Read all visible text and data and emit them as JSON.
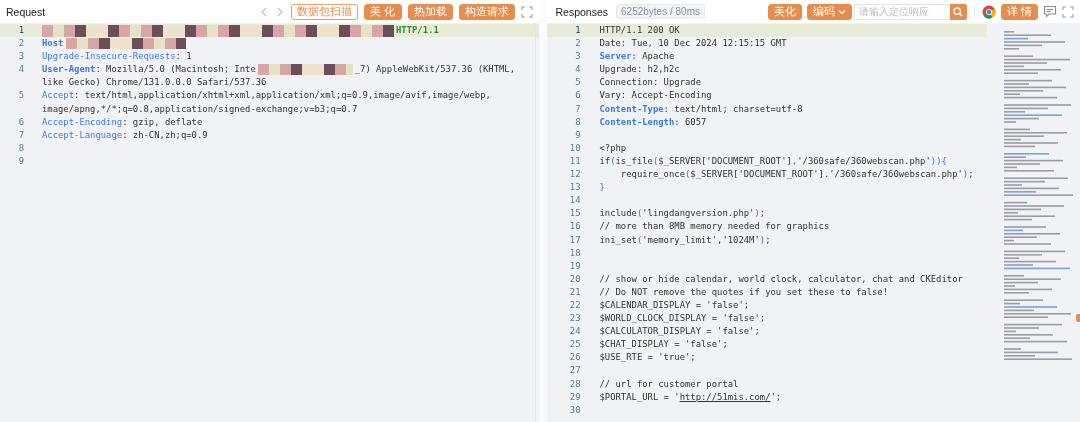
{
  "request": {
    "title": "Request",
    "toolbar": [
      {
        "kind": "prev"
      },
      {
        "kind": "next"
      },
      {
        "kind": "outline",
        "label": "数据包扫描"
      },
      {
        "kind": "filled",
        "label": "美 化"
      },
      {
        "kind": "filled",
        "label": "热加载"
      },
      {
        "kind": "filled",
        "label": "构造请求"
      },
      {
        "kind": "expand"
      }
    ],
    "lines": [
      {
        "number": "1",
        "highlighted": true,
        "rows": [
          [
            {
              "kind": "redacted_line"
            },
            {
              "kind": "proto",
              "text": "HTTP/1.1"
            }
          ]
        ]
      },
      {
        "number": "2",
        "highlighted": false,
        "rows": [
          [
            {
              "kind": "key_strong",
              "text": "Host"
            },
            {
              "kind": "redacted_word"
            }
          ]
        ]
      },
      {
        "number": "3",
        "highlighted": false,
        "rows": [
          [
            {
              "kind": "key",
              "text": "Upgrade-Insecure-Requests"
            },
            {
              "kind": "text",
              "text": ": 1"
            }
          ]
        ]
      },
      {
        "number": "4",
        "highlighted": false,
        "rows": [
          [
            {
              "kind": "key_strong",
              "text": "User-Agent"
            },
            {
              "kind": "text",
              "text": ": Mozilla/5.0 (Macintosh; Inte"
            },
            {
              "kind": "redacted_short"
            },
            {
              "kind": "text",
              "text": "_7) AppleWebKit/537.36 (KHTML,"
            }
          ],
          [
            {
              "kind": "text",
              "text": "like Gecko) Chrome/131.0.0.0 Safari/537.36"
            }
          ]
        ]
      },
      {
        "number": "5",
        "highlighted": false,
        "rows": [
          [
            {
              "kind": "key",
              "text": "Accept"
            },
            {
              "kind": "text",
              "text": ": text/html,application/xhtml+xml,application/xml;q=0.9,image/avif,image/webp,"
            }
          ],
          [
            {
              "kind": "text",
              "text": "image/apng,*/*;q=0.8,application/signed-exchange;v=b3;q=0.7"
            }
          ]
        ]
      },
      {
        "number": "6",
        "highlighted": false,
        "rows": [
          [
            {
              "kind": "key",
              "text": "Accept-Encoding"
            },
            {
              "kind": "text",
              "text": ": gzip, deflate"
            }
          ]
        ]
      },
      {
        "number": "7",
        "highlighted": false,
        "rows": [
          [
            {
              "kind": "key",
              "text": "Accept-Language"
            },
            {
              "kind": "text",
              "text": ": zh-CN,zh;q=0.9"
            }
          ]
        ]
      },
      {
        "number": "8",
        "highlighted": false,
        "rows": [
          []
        ]
      },
      {
        "number": "9",
        "highlighted": false,
        "rows": [
          []
        ]
      }
    ]
  },
  "response": {
    "title": "Responses",
    "stats": "6252bytes / 80ms",
    "toolbar": [
      {
        "kind": "filled",
        "label": "美化"
      },
      {
        "kind": "dropdown",
        "label": "编码"
      },
      {
        "kind": "search",
        "placeholder": "请输入定位响应"
      },
      {
        "kind": "browser"
      },
      {
        "kind": "filled",
        "label": "详 情"
      },
      {
        "kind": "comment"
      },
      {
        "kind": "expand"
      }
    ],
    "lines": [
      {
        "number": "1",
        "highlighted": true,
        "rows": [
          [
            {
              "kind": "text",
              "text": "HTTP/1.1 200 OK"
            }
          ]
        ]
      },
      {
        "number": "2",
        "highlighted": false,
        "rows": [
          [
            {
              "kind": "text",
              "text": "Date: Tue, 10 Dec 2024 12:15:15 GMT"
            }
          ]
        ]
      },
      {
        "number": "3",
        "highlighted": false,
        "rows": [
          [
            {
              "kind": "key_strong",
              "text": "Server:"
            },
            {
              "kind": "text",
              "text": " Apache"
            }
          ]
        ]
      },
      {
        "number": "4",
        "highlighted": false,
        "rows": [
          [
            {
              "kind": "text",
              "text": "Upgrade: h2,h2c"
            }
          ]
        ]
      },
      {
        "number": "5",
        "highlighted": false,
        "rows": [
          [
            {
              "kind": "text",
              "text": "Connection: Upgrade"
            }
          ]
        ]
      },
      {
        "number": "6",
        "highlighted": false,
        "rows": [
          [
            {
              "kind": "text",
              "text": "Vary: Accept-Encoding"
            }
          ]
        ]
      },
      {
        "number": "7",
        "highlighted": false,
        "rows": [
          [
            {
              "kind": "key_strong",
              "text": "Content-Type:"
            },
            {
              "kind": "text",
              "text": " text/html; charset=utf-8"
            }
          ]
        ]
      },
      {
        "number": "8",
        "highlighted": false,
        "rows": [
          [
            {
              "kind": "key_strong",
              "text": "Content-Length:"
            },
            {
              "kind": "text",
              "text": " 6057"
            }
          ]
        ]
      },
      {
        "number": "9",
        "highlighted": false,
        "rows": [
          []
        ]
      },
      {
        "number": "10",
        "highlighted": false,
        "rows": [
          [
            {
              "kind": "text",
              "text": "<?php"
            }
          ]
        ]
      },
      {
        "number": "11",
        "highlighted": false,
        "rows": [
          [
            {
              "kind": "text",
              "text": "if"
            },
            {
              "kind": "paren",
              "text": "("
            },
            {
              "kind": "text",
              "text": "is_file"
            },
            {
              "kind": "paren",
              "text": "("
            },
            {
              "kind": "text",
              "text": "$_SERVER['DOCUMENT_ROOT'].'/360safe/360webscan.php'"
            },
            {
              "kind": "paren",
              "text": "))"
            },
            {
              "kind": "paren",
              "text": "{"
            }
          ]
        ]
      },
      {
        "number": "12",
        "highlighted": false,
        "rows": [
          [
            {
              "kind": "text",
              "text": "    require_once"
            },
            {
              "kind": "paren",
              "text": "("
            },
            {
              "kind": "text",
              "text": "$_SERVER['DOCUMENT_ROOT'].'/360safe/360webscan.php'"
            },
            {
              "kind": "paren",
              "text": ")"
            },
            {
              "kind": "text",
              "text": ";"
            }
          ]
        ]
      },
      {
        "number": "13",
        "highlighted": false,
        "rows": [
          [
            {
              "kind": "paren",
              "text": "}"
            }
          ]
        ]
      },
      {
        "number": "14",
        "highlighted": false,
        "rows": [
          []
        ]
      },
      {
        "number": "15",
        "highlighted": false,
        "rows": [
          [
            {
              "kind": "text",
              "text": "include"
            },
            {
              "kind": "paren",
              "text": "("
            },
            {
              "kind": "text",
              "text": "'lingdangversion.php'"
            },
            {
              "kind": "paren",
              "text": ")"
            },
            {
              "kind": "text",
              "text": ";"
            }
          ]
        ]
      },
      {
        "number": "16",
        "highlighted": false,
        "rows": [
          [
            {
              "kind": "text",
              "text": "// more than 8MB memory needed for graphics"
            }
          ]
        ]
      },
      {
        "number": "17",
        "highlighted": false,
        "rows": [
          [
            {
              "kind": "text",
              "text": "ini_set"
            },
            {
              "kind": "paren",
              "text": "("
            },
            {
              "kind": "text",
              "text": "'memory_limit','1024M'"
            },
            {
              "kind": "paren",
              "text": ")"
            },
            {
              "kind": "text",
              "text": ";"
            }
          ]
        ]
      },
      {
        "number": "18",
        "highlighted": false,
        "rows": [
          []
        ]
      },
      {
        "number": "19",
        "highlighted": false,
        "rows": [
          []
        ]
      },
      {
        "number": "20",
        "highlighted": false,
        "rows": [
          [
            {
              "kind": "text",
              "text": "// show or hide calendar, world clock, calculator, chat and CKEditor"
            }
          ]
        ]
      },
      {
        "number": "21",
        "highlighted": false,
        "rows": [
          [
            {
              "kind": "text",
              "text": "// Do NOT remove the quotes if you set these to false!"
            }
          ]
        ]
      },
      {
        "number": "22",
        "highlighted": false,
        "rows": [
          [
            {
              "kind": "text",
              "text": "$CALENDAR_DISPLAY = 'false';"
            }
          ]
        ]
      },
      {
        "number": "23",
        "highlighted": false,
        "rows": [
          [
            {
              "kind": "text",
              "text": "$WORLD_CLOCK_DISPLAY = 'false';"
            }
          ]
        ]
      },
      {
        "number": "24",
        "highlighted": false,
        "rows": [
          [
            {
              "kind": "text",
              "text": "$CALCULATOR_DISPLAY = 'false';"
            }
          ]
        ]
      },
      {
        "number": "25",
        "highlighted": false,
        "rows": [
          [
            {
              "kind": "text",
              "text": "$CHAT_DISPLAY = 'false';"
            }
          ]
        ]
      },
      {
        "number": "26",
        "highlighted": false,
        "rows": [
          [
            {
              "kind": "text",
              "text": "$USE_RTE = 'true';"
            }
          ]
        ]
      },
      {
        "number": "27",
        "highlighted": false,
        "rows": [
          []
        ]
      },
      {
        "number": "28",
        "highlighted": false,
        "rows": [
          [
            {
              "kind": "text",
              "text": "// url for customer portal"
            }
          ]
        ]
      },
      {
        "number": "29",
        "highlighted": false,
        "rows": [
          [
            {
              "kind": "text",
              "text": "$PORTAL_URL = '"
            },
            {
              "kind": "link",
              "text": "http://51mis.com/"
            },
            {
              "kind": "text",
              "text": "';"
            }
          ]
        ]
      },
      {
        "number": "30",
        "highlighted": false,
        "rows": [
          []
        ]
      }
    ]
  }
}
